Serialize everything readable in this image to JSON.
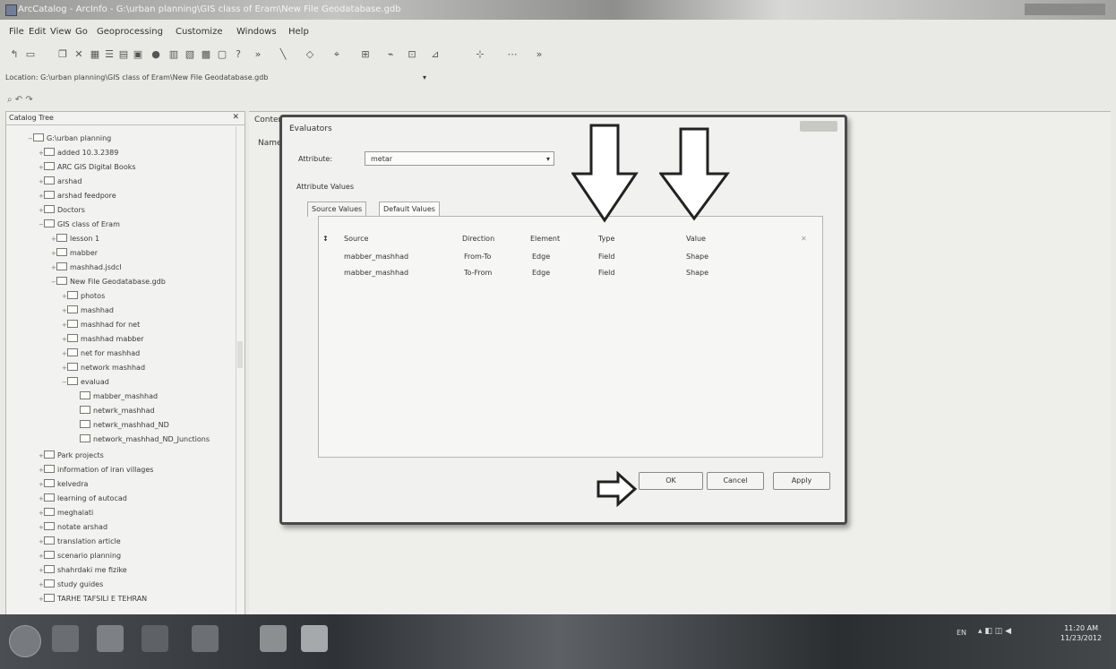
{
  "window": {
    "title": "ArcCatalog - ArcInfo - G:\\urban planning\\GIS class of Eram\\New File Geodatabase.gdb"
  },
  "menu": [
    "File",
    "Edit",
    "View",
    "Go",
    "Geoprocessing",
    "Customize",
    "Windows",
    "Help"
  ],
  "location": {
    "label": "Location: G:\\urban planning\\GIS class of Eram\\New File Geodatabase.gdb"
  },
  "catalog": {
    "title": "Catalog Tree",
    "items": [
      "G:\\urban planning",
      "added 10.3.2389",
      "ARC GIS Digital Books",
      "arshad",
      "arshad feedpore",
      "Doctors",
      "GIS class of Eram",
      "lesson 1",
      "mabber",
      "mashhad.jsdcl",
      "New File Geodatabase.gdb",
      "photos",
      "mashhad",
      "mashhad for net",
      "mashhad mabber",
      "net for mashhad",
      "network mashhad",
      "evaluad",
      "mabber_mashhad",
      "netwrk_mashhad",
      "netwrk_mashhad_ND",
      "network_mashhad_ND_Junctions",
      "Park projects",
      "information of iran villages",
      "kelvedra",
      "learning of autocad",
      "meghalati",
      "notate arshad",
      "translation article",
      "scenario planning",
      "shahrdaki me fizike",
      "study guides",
      "TARHE TAFSILI E TEHRAN"
    ]
  },
  "contents": {
    "tab": "Contents",
    "name_header": "Name"
  },
  "dialog": {
    "title": "Evaluators",
    "attribute_label": "Attribute:",
    "attribute_value": "metar",
    "attribute_values_label": "Attribute Values",
    "tabs": [
      "Source Values",
      "Default Values"
    ],
    "columns": [
      "Source",
      "Direction",
      "Element",
      "Type",
      "Value"
    ],
    "rows": [
      {
        "source": "mabber_mashhad",
        "direction": "From-To",
        "element": "Edge",
        "type": "Field",
        "value": "Shape"
      },
      {
        "source": "mabber_mashhad",
        "direction": "To-From",
        "element": "Edge",
        "type": "Field",
        "value": "Shape"
      }
    ],
    "ok": "OK",
    "cancel": "Cancel",
    "apply": "Apply"
  },
  "taskbar": {
    "tray": "EN",
    "time": "11:20 AM",
    "date": "11/23/2012"
  }
}
